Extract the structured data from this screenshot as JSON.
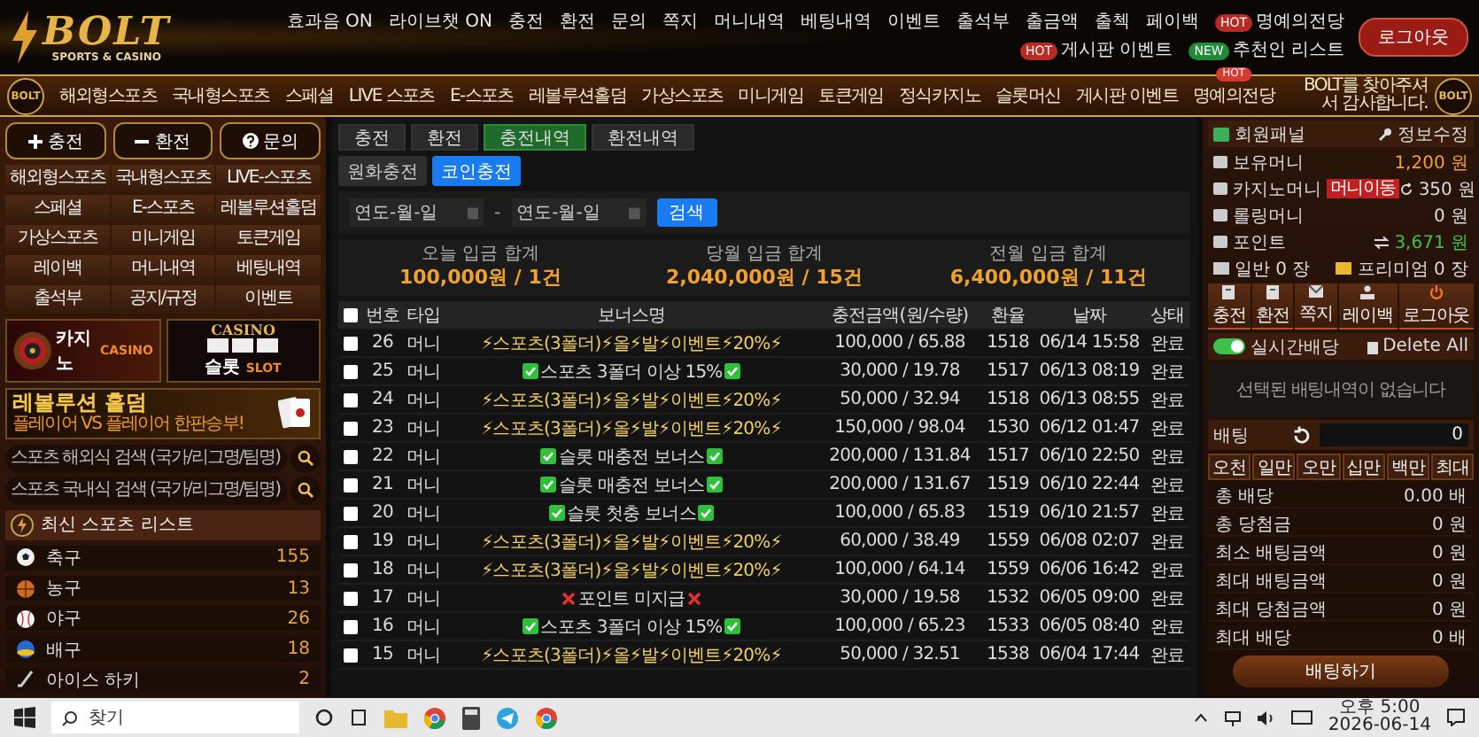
{
  "header": {
    "logo": {
      "title": "BOLT",
      "subtitle": "SPORTS & CASINO"
    },
    "links": [
      {
        "label": "효과음 ON"
      },
      {
        "label": "라이브챗 ON"
      },
      {
        "label": "충전"
      },
      {
        "label": "환전"
      },
      {
        "label": "문의"
      },
      {
        "label": "쪽지"
      },
      {
        "label": "머니내역"
      },
      {
        "label": "베팅내역"
      },
      {
        "label": "이벤트"
      },
      {
        "label": "출석부"
      },
      {
        "label": "출금액"
      },
      {
        "label": "출첵"
      },
      {
        "label": "페이백"
      },
      {
        "label": "명예의전당",
        "badge": {
          "text": "HOT",
          "color": "#b82a22"
        }
      },
      {
        "label": "게시판 이벤트",
        "badge": {
          "text": "HOT",
          "color": "#b82a22"
        }
      },
      {
        "label": "추천인 리스트",
        "badge": {
          "text": "NEW",
          "color": "#1f8a3a"
        }
      }
    ],
    "logout": "로그아웃"
  },
  "nav": {
    "emblems": [
      "BOLT",
      "BOLT"
    ],
    "items": [
      {
        "label": "해외형스포츠"
      },
      {
        "label": "국내형스포츠"
      },
      {
        "label": "스페셜"
      },
      {
        "label": "LIVE 스포츠"
      },
      {
        "label": "E-스포츠"
      },
      {
        "label": "레볼루션홀덤"
      },
      {
        "label": "가상스포츠"
      },
      {
        "label": "미니게임"
      },
      {
        "label": "토큰게임"
      },
      {
        "label": "정식카지노"
      },
      {
        "label": "슬롯머신"
      },
      {
        "label": "게시판 이벤트"
      },
      {
        "label": "명예의전당",
        "badge": "HOT"
      }
    ],
    "welcome": "BOLT를 찾아주셔서 감사합니다."
  },
  "sidebar": {
    "buttons": [
      {
        "label": "충전",
        "kind": "plus"
      },
      {
        "label": "환전",
        "kind": "minus"
      },
      {
        "label": "문의",
        "kind": "question"
      }
    ],
    "menu": [
      "해외형스포츠",
      "국내형스포츠",
      "LIVE-스포츠",
      "스페셜",
      "E-스포츠",
      "레볼루션홀덤",
      "가상스포츠",
      "미니게임",
      "토큰게임",
      "레이백",
      "머니내역",
      "베팅내역",
      "출석부",
      "공지/규정",
      "이벤트"
    ],
    "banners": [
      {
        "kind": "casino",
        "title": "카지노",
        "subtitle": "CASINO"
      },
      {
        "kind": "slot",
        "sign": "CASINO",
        "title": "슬롯",
        "subtitle": "SLOT"
      }
    ],
    "promo": {
      "title": "레볼루션 홀덤",
      "subtitle": "플레이어 VS 플레이어 한판승부!"
    },
    "searches": [
      {
        "placeholder": "스포츠 해외식 검색 (국가/리그명/팀명)"
      },
      {
        "placeholder": "스포츠 국내식 검색 (국가/리그명/팀명)"
      }
    ],
    "sports": {
      "title": "최신 스포츠 리스트",
      "items": [
        {
          "name": "축구",
          "count": "155",
          "kind": "soccer"
        },
        {
          "name": "농구",
          "count": "13",
          "kind": "basketball"
        },
        {
          "name": "야구",
          "count": "26",
          "kind": "baseball"
        },
        {
          "name": "배구",
          "count": "18",
          "kind": "volleyball"
        },
        {
          "name": "아이스 하키",
          "count": "2",
          "kind": "hockey"
        }
      ]
    }
  },
  "main": {
    "tabs": [
      {
        "label": "충전",
        "selected": false
      },
      {
        "label": "환전",
        "selected": false
      },
      {
        "label": "충전내역",
        "selected": true
      },
      {
        "label": "환전내역",
        "selected": false
      }
    ],
    "subtabs": [
      {
        "label": "원화충전",
        "selected": false
      },
      {
        "label": "코인충전",
        "selected": true
      }
    ],
    "filter": {
      "from": {
        "placeholder": "연도-월-일"
      },
      "separator": "-",
      "to": {
        "placeholder": "연도-월-일"
      },
      "button": "검색"
    },
    "summary": [
      {
        "label": "오늘 입금 합계",
        "value": "100,000원 / 1건"
      },
      {
        "label": "당월 입금 합계",
        "value": "2,040,000원 / 15건"
      },
      {
        "label": "전월 입금 합계",
        "value": "6,400,000원 / 11건"
      }
    ],
    "table": {
      "select_all": {
        "checked": false
      },
      "columns": [
        "번호",
        "타입",
        "보너스명",
        "충전금액(원/수량)",
        "환율",
        "날짜",
        "상태"
      ],
      "rows": [
        {
          "checked": false,
          "no": "26",
          "type": "머니",
          "bonus": {
            "kind": "bolt",
            "text": "⚡스포츠(3폴더)⚡올⚡발⚡이벤트⚡20%⚡"
          },
          "amount": "100,000 / 65.88",
          "rate": "1518",
          "date": "06/14 15:58",
          "status": "완료"
        },
        {
          "checked": false,
          "no": "25",
          "type": "머니",
          "bonus": {
            "kind": "check",
            "text": "스포츠 3폴더 이상 15%"
          },
          "amount": "30,000 / 19.78",
          "rate": "1517",
          "date": "06/13 08:19",
          "status": "완료"
        },
        {
          "checked": false,
          "no": "24",
          "type": "머니",
          "bonus": {
            "kind": "bolt",
            "text": "⚡스포츠(3폴더)⚡올⚡발⚡이벤트⚡20%⚡"
          },
          "amount": "50,000 / 32.94",
          "rate": "1518",
          "date": "06/13 08:55",
          "status": "완료"
        },
        {
          "checked": false,
          "no": "23",
          "type": "머니",
          "bonus": {
            "kind": "bolt",
            "text": "⚡스포츠(3폴더)⚡올⚡발⚡이벤트⚡20%⚡"
          },
          "amount": "150,000 / 98.04",
          "rate": "1530",
          "date": "06/12 01:47",
          "status": "완료"
        },
        {
          "checked": false,
          "no": "22",
          "type": "머니",
          "bonus": {
            "kind": "check",
            "text": "슬롯 매충전 보너스"
          },
          "amount": "200,000 / 131.84",
          "rate": "1517",
          "date": "06/10 22:50",
          "status": "완료"
        },
        {
          "checked": false,
          "no": "21",
          "type": "머니",
          "bonus": {
            "kind": "check",
            "text": "슬롯 매충전 보너스"
          },
          "amount": "200,000 / 131.67",
          "rate": "1519",
          "date": "06/10 22:44",
          "status": "완료"
        },
        {
          "checked": false,
          "no": "20",
          "type": "머니",
          "bonus": {
            "kind": "check",
            "text": "슬롯 첫충 보너스"
          },
          "amount": "100,000 / 65.83",
          "rate": "1519",
          "date": "06/10 21:57",
          "status": "완료"
        },
        {
          "checked": false,
          "no": "19",
          "type": "머니",
          "bonus": {
            "kind": "bolt",
            "text": "⚡스포츠(3폴더)⚡올⚡발⚡이벤트⚡20%⚡"
          },
          "amount": "60,000 / 38.49",
          "rate": "1559",
          "date": "06/08 02:07",
          "status": "완료"
        },
        {
          "checked": false,
          "no": "18",
          "type": "머니",
          "bonus": {
            "kind": "bolt",
            "text": "⚡스포츠(3폴더)⚡올⚡발⚡이벤트⚡20%⚡"
          },
          "amount": "100,000 / 64.14",
          "rate": "1559",
          "date": "06/06 16:42",
          "status": "완료"
        },
        {
          "checked": false,
          "no": "17",
          "type": "머니",
          "bonus": {
            "kind": "cross",
            "text": "포인트 미지급"
          },
          "amount": "30,000 / 19.58",
          "rate": "1532",
          "date": "06/05 09:00",
          "status": "완료"
        },
        {
          "checked": false,
          "no": "16",
          "type": "머니",
          "bonus": {
            "kind": "check",
            "text": "스포츠 3폴더 이상 15%"
          },
          "amount": "100,000 / 65.23",
          "rate": "1533",
          "date": "06/05 08:40",
          "status": "완료"
        },
        {
          "checked": false,
          "no": "15",
          "type": "머니",
          "bonus": {
            "kind": "bolt",
            "text": "⚡스포츠(3폴더)⚡올⚡발⚡이벤트⚡20%⚡"
          },
          "amount": "50,000 / 32.51",
          "rate": "1538",
          "date": "06/04 17:44",
          "status": "완료"
        }
      ]
    }
  },
  "panel": {
    "title": "회원패널",
    "edit": "정보수정",
    "balances": [
      {
        "label": "보유머니",
        "value": "1,200 원",
        "kind": "money"
      },
      {
        "label": "카지노머니",
        "badge": "머니이동",
        "value": "350 원",
        "kind": "casino"
      },
      {
        "label": "롤링머니",
        "value": "0 원",
        "kind": "rolling"
      },
      {
        "label": "포인트",
        "value": "3,671 원",
        "kind": "point"
      }
    ],
    "tickets": [
      {
        "label": "일반 0 장",
        "kind": "normal"
      },
      {
        "label": "프리미엄 0 장",
        "kind": "premium"
      }
    ],
    "actions": [
      {
        "label": "충전",
        "kind": "deposit"
      },
      {
        "label": "환전",
        "kind": "withdraw"
      },
      {
        "label": "쪽지",
        "kind": "mail"
      },
      {
        "label": "레이백",
        "kind": "rakeback"
      },
      {
        "label": "로그아웃",
        "kind": "logout"
      }
    ],
    "live": {
      "label": "실시간배당",
      "on": true
    },
    "delete": "Delete All",
    "empty": "선택된 배팅내역이 없습니다",
    "bet": {
      "label": "배팅",
      "value": "0"
    },
    "chips": [
      "오천",
      "일만",
      "오만",
      "십만",
      "백만",
      "최대"
    ],
    "stats": [
      {
        "label": "총 배당",
        "value": "0.00 배"
      },
      {
        "label": "총 당첨금",
        "value": "0 원"
      },
      {
        "label": "최소 배팅금액",
        "value": "0 원"
      },
      {
        "label": "최대 배팅금액",
        "value": "0 원"
      },
      {
        "label": "최대 당첨금액",
        "value": "0 원"
      },
      {
        "label": "최대 배당",
        "value": "0 배"
      }
    ],
    "submit": "배팅하기"
  },
  "taskbar": {
    "search": {
      "placeholder": "찾기"
    },
    "clock": {
      "time": "오후 5:00",
      "date": "2026-06-14"
    }
  }
}
